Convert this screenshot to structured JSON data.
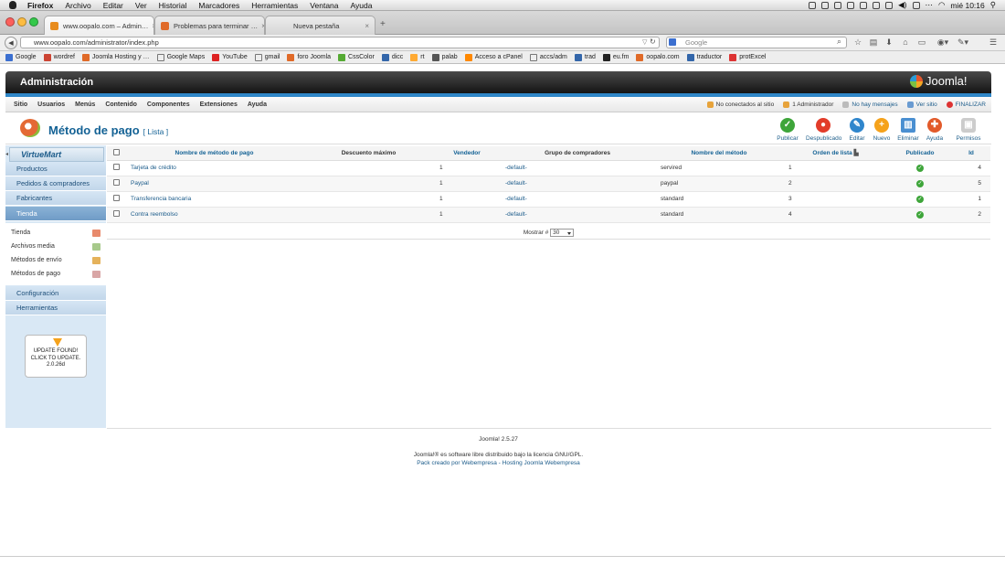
{
  "menubar": {
    "items": [
      "Firefox",
      "Archivo",
      "Editar",
      "Ver",
      "Historial",
      "Marcadores",
      "Herramientas",
      "Ventana",
      "Ayuda"
    ],
    "clock": "mié 10:16"
  },
  "tabs": [
    {
      "title": "www.oopalo.com – Admin…",
      "close": "×"
    },
    {
      "title": "Problemas para terminar …",
      "close": "×"
    },
    {
      "title": "Nueva pestaña",
      "close": "×"
    }
  ],
  "newtab": "+",
  "navbar": {
    "url": "www.oopalo.com/administrator/index.php",
    "search_placeholder": "Google",
    "back": "◀"
  },
  "bookmarks": [
    "Google",
    "wordref",
    "Joomla Hosting y …",
    "Google Maps",
    "YouTube",
    "gmail",
    "foro Joomla",
    "CssColor",
    "dicc",
    "rt",
    "palab",
    "Acceso a cPanel",
    "accs/adm",
    "trad",
    "eu.fm",
    "oopalo.com",
    "traductor",
    "protExcel"
  ],
  "joomla": {
    "title": "Administración",
    "logo": "Joomla!",
    "menu": [
      "Sitio",
      "Usuarios",
      "Menús",
      "Contenido",
      "Componentes",
      "Extensiones",
      "Ayuda"
    ],
    "status": [
      "No conectados al sitio",
      "1 Administrador",
      "No hay mensajes",
      "Ver sitio",
      "FINALIZAR"
    ]
  },
  "page": {
    "title": "Método de pago",
    "subtitle": "[ Lista ]"
  },
  "toolbar": [
    "Publicar",
    "Despublicado",
    "Editar",
    "Nuevo",
    "Eliminar",
    "Ayuda",
    "Permisos"
  ],
  "sidebar": {
    "logo": "VirtueMart",
    "main": [
      "Productos",
      "Pedidos & compradores",
      "Fabricantes",
      "Tienda"
    ],
    "sub": [
      "Tienda",
      "Archivos media",
      "Métodos de envío",
      "Métodos de pago"
    ],
    "bottom": [
      "Configuración",
      "Herramientas"
    ],
    "update": [
      "UPDATE FOUND!",
      "CLICK TO UPDATE.",
      "2.0.26d"
    ]
  },
  "table": {
    "headers": [
      "Nombre de método de pago",
      "Descuento máximo",
      "Vendedor",
      "Grupo de compradores",
      "Nombre del método",
      "Orden de lista",
      "Publicado",
      "Id"
    ],
    "rows": [
      {
        "name": "Tarjeta de crédito",
        "descuento": "",
        "vendedor": "1",
        "grupo": "-default-",
        "metodo": "servired",
        "orden": "1",
        "id": "4"
      },
      {
        "name": "Paypal",
        "descuento": "",
        "vendedor": "1",
        "grupo": "-default-",
        "metodo": "paypal",
        "orden": "2",
        "id": "5"
      },
      {
        "name": "Transferencia bancaria",
        "descuento": "",
        "vendedor": "1",
        "grupo": "-default-",
        "metodo": "standard",
        "orden": "3",
        "id": "1"
      },
      {
        "name": "Contra reembolso",
        "descuento": "",
        "vendedor": "1",
        "grupo": "-default-",
        "metodo": "standard",
        "orden": "4",
        "id": "2"
      }
    ],
    "pager_label": "Mostrar #",
    "pager_value": "30"
  },
  "footer": {
    "version": "Joomla! 2.5.27",
    "license": "Joomla!® es software libre distribuido bajo la licencia GNU/GPL.",
    "pack": "Pack creado por Webempresa - Hosting Joomla Webempresa"
  }
}
